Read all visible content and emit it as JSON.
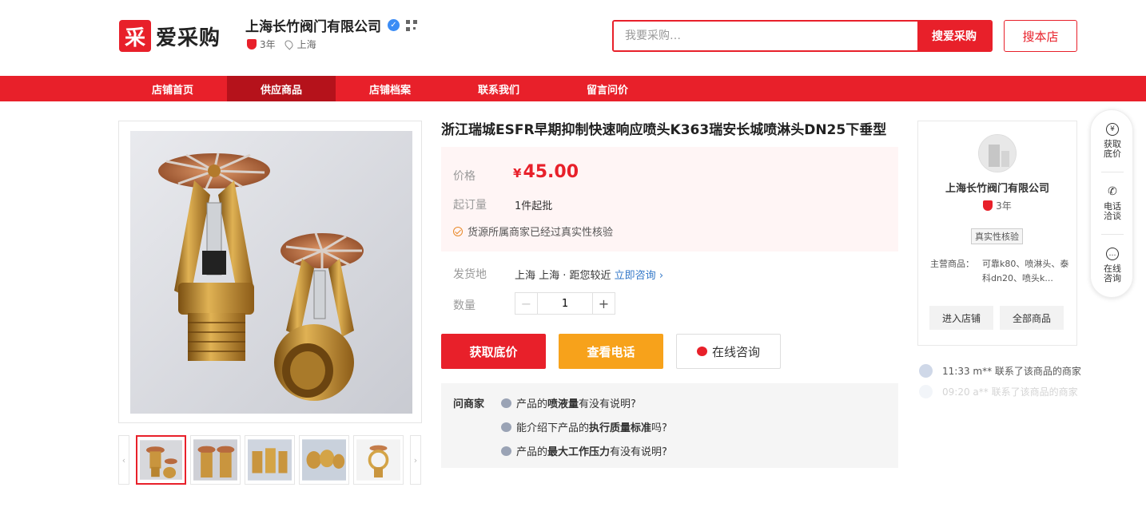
{
  "header": {
    "logo_mark": "采",
    "logo_text": "爱采购",
    "shop_name": "上海长竹阀门有限公司",
    "shop_years": "3年",
    "shop_location": "上海",
    "search_placeholder": "我要采购…",
    "search_button": "搜爱采购",
    "store_search_button": "搜本店"
  },
  "nav": {
    "items": [
      "店铺首页",
      "供应商品",
      "店铺档案",
      "联系我们",
      "留言问价"
    ],
    "active_index": 1
  },
  "product": {
    "title": "浙江瑞城ESFR早期抑制快速响应喷头K363瑞安长城喷淋头DN25下垂型",
    "price_label": "价格",
    "currency": "¥",
    "price": "45.00",
    "moq_label": "起订量",
    "moq_value": "1件起批",
    "verified_note": "货源所属商家已经过真实性核验",
    "ship_label": "发货地",
    "ship_value": "上海 上海 · 距您较近",
    "consult_link": "立即咨询",
    "qty_label": "数量",
    "qty_value": "1",
    "btn_get_price": "获取底价",
    "btn_view_phone": "查看电话",
    "btn_online": "在线咨询",
    "ask_label": "问商家",
    "questions": [
      {
        "pre": "产品的",
        "bold": "喷液量",
        "post": "有没有说明?"
      },
      {
        "pre": "能介绍下产品的",
        "bold": "执行质量标准",
        "post": "吗?"
      },
      {
        "pre": "产品的",
        "bold": "最大工作压力",
        "post": "有没有说明?"
      }
    ]
  },
  "store_card": {
    "name": "上海长竹阀门有限公司",
    "years": "3年",
    "verify_tag": "真实性核验",
    "main_products_label": "主营商品：",
    "main_products": "可靠k80、喷淋头、泰科dn20、喷头k...",
    "enter_store": "进入店铺",
    "all_products": "全部商品"
  },
  "activity": [
    {
      "text": "11:33 m** 联系了该商品的商家"
    },
    {
      "text": "09:20 a** 联系了该商品的商家"
    }
  ],
  "side_float": {
    "items": [
      {
        "icon": "¥",
        "label": "获取\n底价"
      },
      {
        "icon": "✆",
        "label": "电话\n洽谈"
      },
      {
        "icon": "…",
        "label": "在线\n咨询"
      }
    ]
  },
  "colors": {
    "brand_red": "#e8202a",
    "nav_active": "#b5121b",
    "orange": "#f7a21b",
    "link_blue": "#3478c8"
  }
}
